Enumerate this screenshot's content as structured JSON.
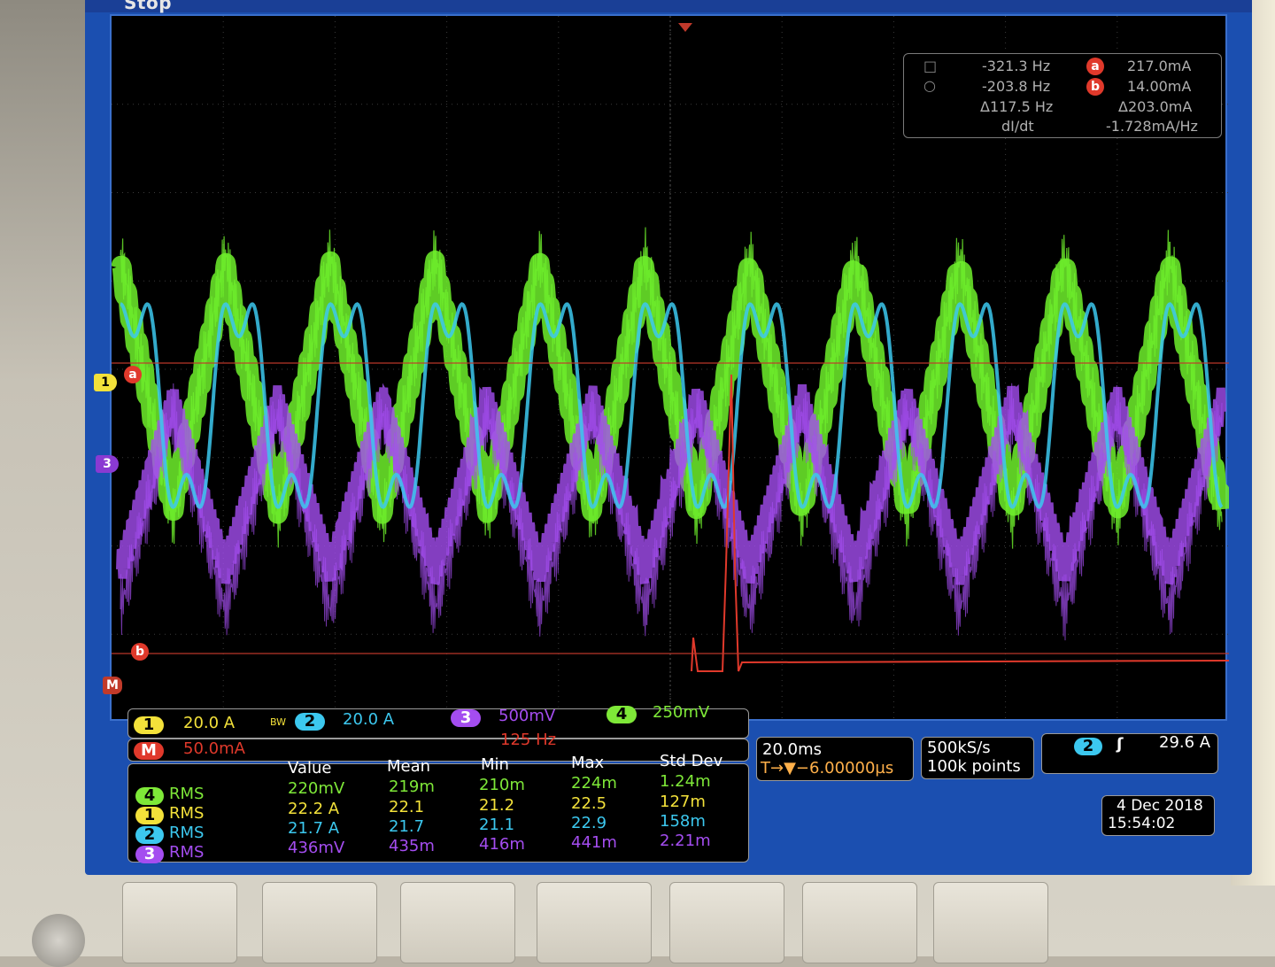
{
  "status": {
    "state_label": "Stop"
  },
  "markers": {
    "ch1": "1",
    "ch3": "3",
    "math": "M",
    "cursor_a": "a",
    "cursor_b": "b"
  },
  "cursor_readout": {
    "row1": {
      "time": "-321.3 Hz",
      "badge": "a",
      "value": "217.0mA"
    },
    "row2": {
      "time": "-203.8 Hz",
      "badge": "b",
      "value": "14.00mA"
    },
    "row3": {
      "time": "Δ117.5 Hz",
      "value": "Δ203.0mA"
    },
    "row4": {
      "time": "dI/dt",
      "value": "-1.728mA/Hz"
    }
  },
  "channels": {
    "ch1": {
      "num": "1",
      "scale": "20.0 A",
      "bw": "BW",
      "color": "#f3e13a"
    },
    "ch2": {
      "num": "2",
      "scale": "20.0 A",
      "color": "#3cc8ef"
    },
    "ch3": {
      "num": "3",
      "scale": "500mV",
      "color": "#a44df0"
    },
    "ch4": {
      "num": "4",
      "scale": "250mV",
      "color": "#7ee838"
    }
  },
  "math": {
    "label": "M",
    "scale": "50.0mA",
    "freq": "125 Hz",
    "color": "#e0392b"
  },
  "measurements": {
    "headers": [
      "Value",
      "Mean",
      "Min",
      "Max",
      "Std Dev"
    ],
    "rows": [
      {
        "ch": "4",
        "type": "RMS",
        "color": "#7ee838",
        "values": [
          "220mV",
          "219m",
          "210m",
          "224m",
          "1.24m"
        ]
      },
      {
        "ch": "1",
        "type": "RMS",
        "color": "#f3e13a",
        "values": [
          "22.2 A",
          "22.1",
          "21.2",
          "22.5",
          "127m"
        ]
      },
      {
        "ch": "2",
        "type": "RMS",
        "color": "#3cc8ef",
        "values": [
          "21.7 A",
          "21.7",
          "21.1",
          "22.9",
          "158m"
        ]
      },
      {
        "ch": "3",
        "type": "RMS",
        "color": "#a44df0",
        "values": [
          "436mV",
          "435m",
          "416m",
          "441m",
          "2.21m"
        ]
      }
    ]
  },
  "timebase": {
    "scale": "20.0ms",
    "delay": "T→▼−6.00000µs"
  },
  "acquisition": {
    "rate": "500kS/s",
    "points": "100k points"
  },
  "trigger": {
    "source": "2",
    "slope": "ʃ",
    "level": "29.6 A"
  },
  "datetime": {
    "date": "4 Dec  2018",
    "time": "15:54:02"
  },
  "waveform_colors": {
    "ch2": "#3cc8ef",
    "ch3": "#a44df0",
    "ch4": "#6ef02c",
    "math": "#e0392b",
    "cursor": "#c0392b"
  }
}
